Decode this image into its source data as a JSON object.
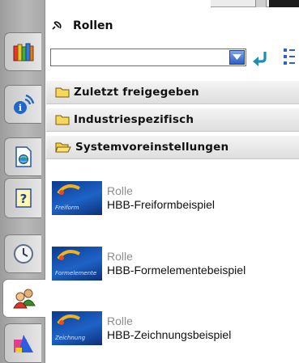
{
  "header": {
    "title": "Rollen"
  },
  "search": {
    "value": ""
  },
  "sections": [
    {
      "label": "Zuletzt freigegeben"
    },
    {
      "label": "Industriespezifisch"
    },
    {
      "label": "Systemvoreinstellungen"
    }
  ],
  "roles": [
    {
      "type": "Rolle",
      "name": "HBB-Freiformbeispiel",
      "thumb_text": "Freiform"
    },
    {
      "type": "Rolle",
      "name": "HBB-Formelementebeispiel",
      "thumb_text": "Formelemente"
    },
    {
      "type": "Rolle",
      "name": "HBB-Zeichnungsbeispiel",
      "thumb_text": "Zeichnung"
    }
  ],
  "tabs": [
    {
      "icon": "books-icon"
    },
    {
      "icon": "info-broadcast-icon"
    },
    {
      "icon": "document-globe-icon"
    },
    {
      "icon": "help-question-icon"
    },
    {
      "icon": "clock-icon"
    },
    {
      "icon": "users-roles-icon",
      "active": true
    },
    {
      "icon": "color-shapes-icon"
    }
  ],
  "colors": {
    "accent_blue": "#2d5fc4",
    "folder_yellow": "#f7d85a",
    "section_bg": "#e6e6e6"
  }
}
